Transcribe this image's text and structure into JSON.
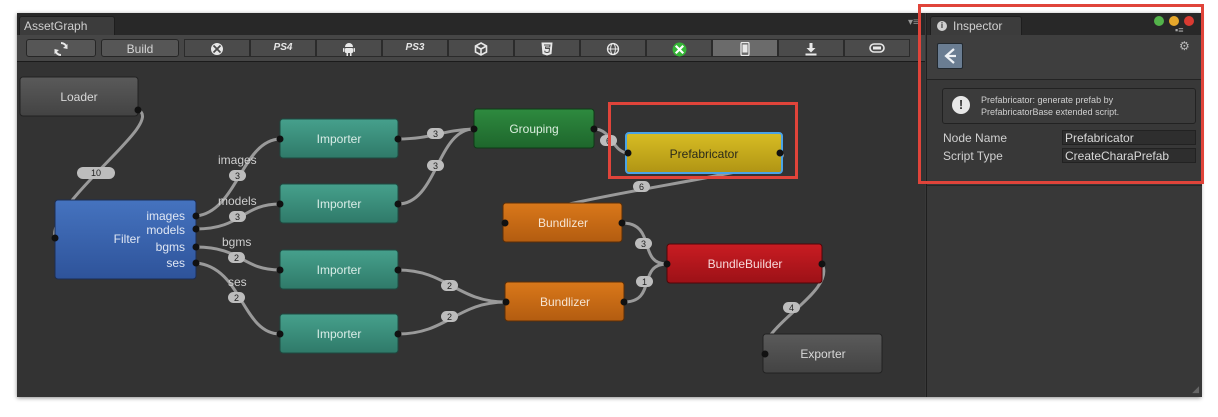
{
  "asset_graph": {
    "tab_title": "AssetGraph",
    "toolbar": {
      "refresh_icon": "refresh-icon",
      "build_label": "Build",
      "platforms": [
        {
          "name": "xbox360",
          "icon": "xbox-icon",
          "label": ""
        },
        {
          "name": "ps4",
          "icon": "text",
          "label": "PS4"
        },
        {
          "name": "android",
          "icon": "android-icon",
          "label": ""
        },
        {
          "name": "ps3",
          "icon": "text",
          "label": "PS3"
        },
        {
          "name": "unity",
          "icon": "unity-icon",
          "label": ""
        },
        {
          "name": "html5",
          "icon": "html5-icon",
          "label": ""
        },
        {
          "name": "web",
          "icon": "globe-icon",
          "label": ""
        },
        {
          "name": "xboxone",
          "icon": "xbox-green-icon",
          "label": ""
        },
        {
          "name": "mobile",
          "icon": "phone-icon",
          "label": "",
          "selected": true
        },
        {
          "name": "download",
          "icon": "download-icon",
          "label": ""
        },
        {
          "name": "pill",
          "icon": "pill-icon",
          "label": ""
        }
      ]
    },
    "nodes": {
      "loader": "Loader",
      "filter": "Filter",
      "filter_outputs": [
        "images",
        "models",
        "bgms",
        "ses"
      ],
      "importer1": "Importer",
      "importer2": "Importer",
      "importer3": "Importer",
      "importer4": "Importer",
      "grouping": "Grouping",
      "prefabricator": "Prefabricator",
      "bundlizer1": "Bundlizer",
      "bundlizer2": "Bundlizer",
      "bundlebuilder": "BundleBuilder",
      "exporter": "Exporter"
    },
    "connections": {
      "loader_filter": {
        "count": "10"
      },
      "images": {
        "label": "images",
        "count": "3"
      },
      "models": {
        "label": "models",
        "count": "3"
      },
      "bgms": {
        "label": "bgms",
        "count": "2"
      },
      "ses": {
        "label": "ses",
        "count": "2"
      },
      "imp1_grouping": {
        "count": "3"
      },
      "imp2_grouping": {
        "count": "3"
      },
      "grouping_prefab": {
        "count": "6"
      },
      "prefab_bundlizer": {
        "count": "6"
      },
      "imp3_bundlizer": {
        "count": "2"
      },
      "imp4_bundlizer": {
        "count": "2"
      },
      "bundlizer1_bb": {
        "count": "3"
      },
      "bundlizer2_bb": {
        "count": "1"
      },
      "bb_exporter": {
        "count": "4"
      }
    },
    "colors": {
      "loader": "#4a4a4a",
      "filter": "#3a62a6",
      "importer": "#3a8f7c",
      "grouping": "#277a37",
      "prefabricator": "#c4a91b",
      "bundlizer": "#c46a16",
      "bundlebuilder": "#b5161c",
      "exporter": "#4a4a4a"
    }
  },
  "inspector": {
    "tab_title": "Inspector",
    "tab_icon": "info-icon",
    "settings_icon": "gear-icon",
    "help_text_line1": "Prefabricator: generate prefab by",
    "help_text_line2": "PrefabricatorBase extended script.",
    "properties": [
      {
        "label": "Node Name",
        "value": "Prefabricator"
      },
      {
        "label": "Script Type",
        "value": "CreateCharaPrefab"
      }
    ]
  }
}
